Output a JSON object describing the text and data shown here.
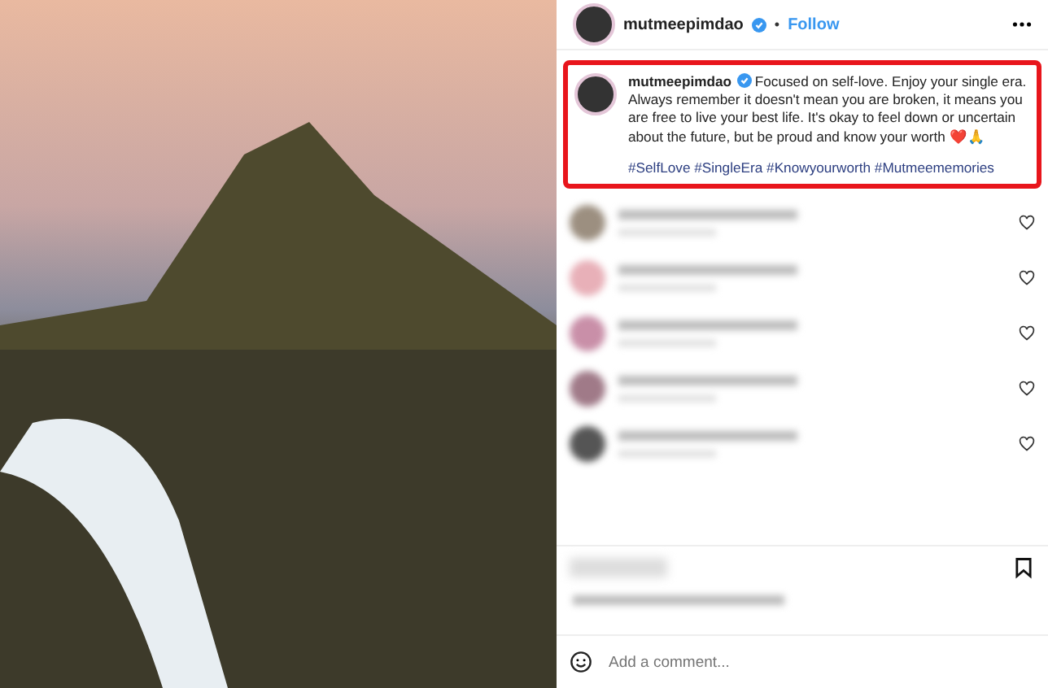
{
  "post": {
    "author": "mutmeepimdao",
    "verified": true,
    "separator": "•",
    "follow": "Follow"
  },
  "caption": {
    "author": "mutmeepimdao",
    "verified": true,
    "text": "Focused on self-love. Enjoy your single era. Always remember it doesn't mean you are broken, it means you are free to live your best life. It's okay to feel down or uncertain about the future, but be proud and know your worth ❤️🙏",
    "hashtags": "#SelfLove #SingleEra #Knowyourworth #Mutmeememories",
    "highlighted": true
  },
  "comment_box": {
    "placeholder": "Add a comment..."
  }
}
